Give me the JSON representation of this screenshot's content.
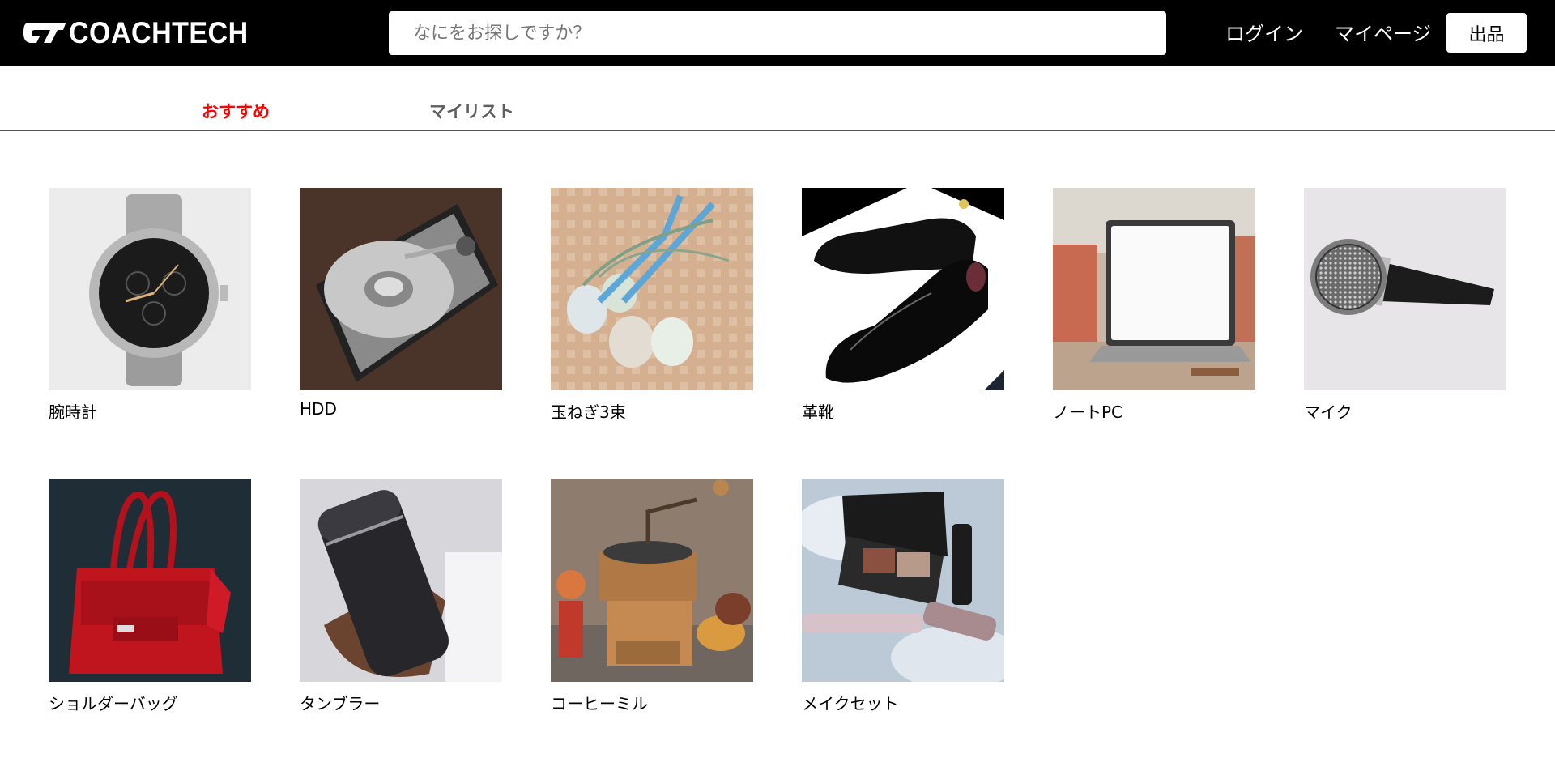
{
  "header": {
    "logo_text": "COACHTECH",
    "search_placeholder": "なにをお探しですか？",
    "search_value": "",
    "login_label": "ログイン",
    "mypage_label": "マイページ",
    "sell_label": "出品"
  },
  "tabs": [
    {
      "label": "おすすめ",
      "active": true,
      "color": "#ff0000"
    },
    {
      "label": "マイリスト",
      "active": false,
      "color": "#5f5f5f"
    }
  ],
  "products": [
    {
      "name": "腕時計",
      "icon": "wristwatch-image"
    },
    {
      "name": "HDD",
      "icon": "hard-disk-image"
    },
    {
      "name": "玉ねぎ3束",
      "icon": "onions-image"
    },
    {
      "name": "革靴",
      "icon": "leather-shoes-image"
    },
    {
      "name": "ノートPC",
      "icon": "laptop-image"
    },
    {
      "name": "マイク",
      "icon": "microphone-image"
    },
    {
      "name": "ショルダーバッグ",
      "icon": "shoulder-bag-image"
    },
    {
      "name": "タンブラー",
      "icon": "tumbler-image"
    },
    {
      "name": "コーヒーミル",
      "icon": "coffee-mill-image"
    },
    {
      "name": "メイクセット",
      "icon": "makeup-set-image"
    }
  ]
}
